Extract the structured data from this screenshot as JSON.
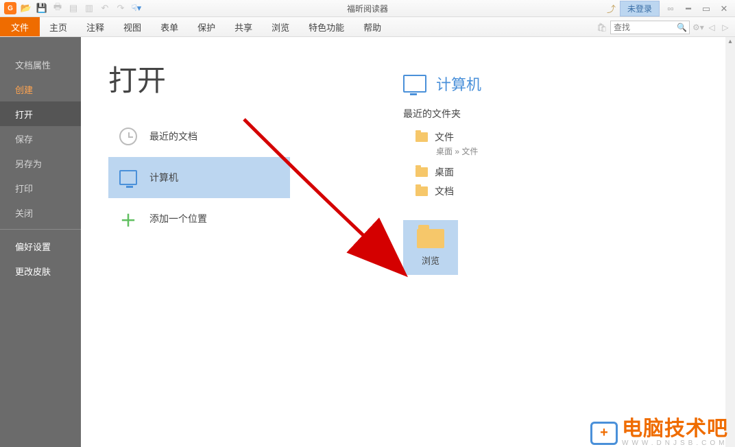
{
  "app": {
    "title": "福昕阅读器",
    "login_label": "未登录"
  },
  "search": {
    "placeholder": "查找"
  },
  "ribbon": {
    "file": "文件",
    "tabs": [
      "主页",
      "注释",
      "视图",
      "表单",
      "保护",
      "共享",
      "浏览",
      "特色功能",
      "帮助"
    ]
  },
  "backstage": {
    "items": [
      {
        "label": "文档属性",
        "cls": ""
      },
      {
        "label": "创建",
        "cls": "orange"
      },
      {
        "label": "打开",
        "cls": "selected"
      },
      {
        "label": "保存",
        "cls": ""
      },
      {
        "label": "另存为",
        "cls": ""
      },
      {
        "label": "打印",
        "cls": ""
      },
      {
        "label": "关闭",
        "cls": ""
      }
    ],
    "bottom": [
      "偏好设置",
      "更改皮肤"
    ]
  },
  "page": {
    "title": "打开",
    "open_options": {
      "recent_docs": "最近的文档",
      "computer": "计算机",
      "add_location": "添加一个位置"
    }
  },
  "right": {
    "heading": "计算机",
    "subheading": "最近的文件夹",
    "folders": [
      {
        "name": "文件",
        "path": "桌面 » 文件"
      },
      {
        "name": "桌面",
        "path": ""
      },
      {
        "name": "文档",
        "path": ""
      }
    ],
    "browse": "浏览"
  },
  "watermark": {
    "main": "电脑技术吧",
    "sub": "WWW.DNJSB.COM"
  }
}
